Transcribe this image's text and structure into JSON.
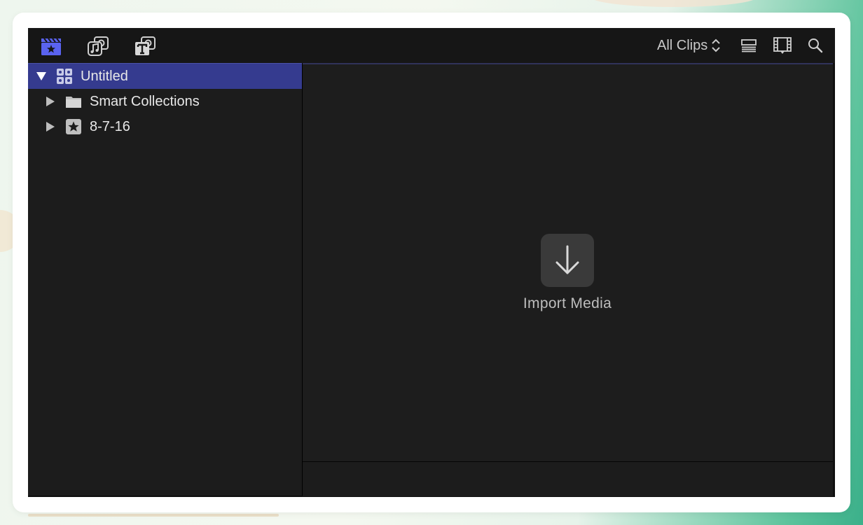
{
  "toolbar": {
    "clip_filter_label": "All Clips"
  },
  "sidebar": {
    "library": {
      "label": "Untitled"
    },
    "items": [
      {
        "label": "Smart Collections"
      },
      {
        "label": "8-7-16"
      }
    ]
  },
  "browser": {
    "import_label": "Import Media"
  },
  "colors": {
    "accent_icon": "#5a63f0",
    "selection": "#353b8f",
    "panel": "#1c1c1c"
  },
  "icons": [
    "clapper-star-icon",
    "music-photo-icon",
    "titles-icon",
    "sort-updown-icon",
    "list-view-icon",
    "filmstrip-icon",
    "search-icon",
    "disclosure-triangle-icon",
    "library-grid-icon",
    "folder-icon",
    "event-star-icon",
    "download-arrow-icon"
  ]
}
